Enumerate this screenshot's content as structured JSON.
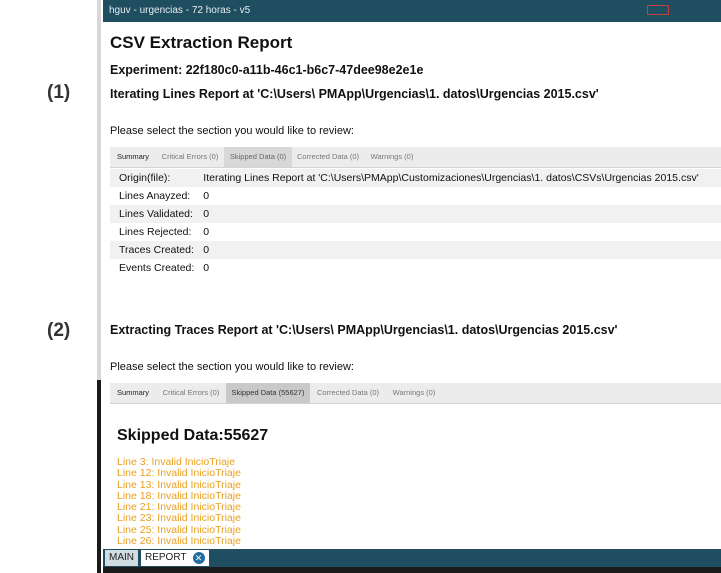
{
  "markers": {
    "one": "(1)",
    "two": "(2)"
  },
  "window": {
    "title": "hguv - urgencias - 72 horas - v5"
  },
  "report": {
    "title": "CSV Extraction Report",
    "experiment": "Experiment: 22f180c0-a11b-46c1-b6c7-47dee98e2e1e",
    "section1": {
      "heading": "Iterating Lines Report at 'C:\\Users\\ PMApp\\Urgencias\\1. datos\\Urgencias 2015.csv'",
      "prompt": "Please select the section you would like to review:",
      "tabs": [
        "Summary",
        "Critical Errors (0)",
        "Skipped Data (0)",
        "Corrected Data (0)",
        "Warnings (0)"
      ],
      "rows": [
        {
          "key": "Origin(file):",
          "value": "Iterating Lines Report at 'C:\\Users\\PMApp\\Customizaciones\\Urgencias\\1. datos\\CSVs\\Urgencias 2015.csv'"
        },
        {
          "key": "Lines Anayzed:",
          "value": "0"
        },
        {
          "key": "Lines Validated:",
          "value": "0"
        },
        {
          "key": "Lines Rejected:",
          "value": "0"
        },
        {
          "key": "Traces Created:",
          "value": "0"
        },
        {
          "key": "Events Created:",
          "value": "0"
        }
      ]
    },
    "section2": {
      "heading": "Extracting Traces Report at 'C:\\Users\\ PMApp\\Urgencias\\1. datos\\Urgencias 2015.csv'",
      "prompt": "Please select the section you would like to review:",
      "tabs": [
        "Summary",
        "Critical Errors (0)",
        "Skipped Data (55627)",
        "Corrected Data (0)",
        "Warnings (0)"
      ],
      "skipped_title": "Skipped Data:55627",
      "skipped_lines": [
        "Line 3: Invalid InicioTriaje",
        "Line 12: Invalid InicioTriaje",
        "Line 13: Invalid InicioTriaje",
        "Line 18: Invalid InicioTriaje",
        "Line 21: Invalid InicioTriaje",
        "Line 23: Invalid InicioTriaje",
        "Line 25: Invalid InicioTriaje",
        "Line 26: Invalid InicioTriaje"
      ]
    }
  },
  "statusbar": {
    "tabs": [
      "MAIN",
      "REPORT"
    ]
  },
  "colors": {
    "titlebar": "#1e4e5f",
    "link": "#e8a020",
    "tab_bg": "#ececec"
  }
}
